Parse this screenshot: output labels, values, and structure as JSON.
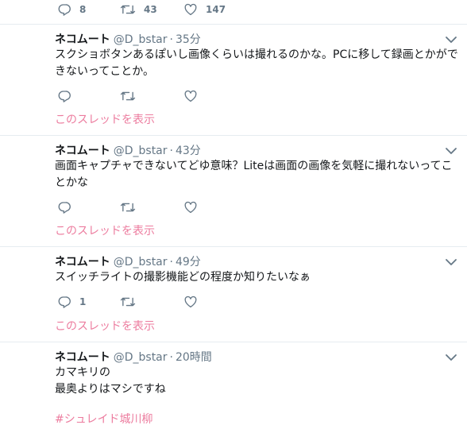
{
  "top_actions": {
    "reply_count": "8",
    "retweet_count": "43",
    "like_count": "147"
  },
  "tweets": [
    {
      "name": "ネコムート",
      "handle": "@D_bstar",
      "separator": "·",
      "time": "35分",
      "text": "スクショボタンあるぽいし画像くらいは撮れるのかな。PCに移して録画とかができないってことか。",
      "reply_count": "",
      "show_thread": "このスレッドを表示"
    },
    {
      "name": "ネコムート",
      "handle": "@D_bstar",
      "separator": "·",
      "time": "43分",
      "text": "画面キャプチャできないてどゆ意味？Liteは画面の画像を気軽に撮れないってことかな",
      "reply_count": "",
      "show_thread": "このスレッドを表示"
    },
    {
      "name": "ネコムート",
      "handle": "@D_bstar",
      "separator": "·",
      "time": "49分",
      "text": "スイッチライトの撮影機能どの程度か知りたいなぁ",
      "reply_count": "1",
      "show_thread": "このスレッドを表示"
    },
    {
      "name": "ネコムート",
      "handle": "@D_bstar",
      "separator": "·",
      "time": "20時間",
      "text": "カマキリの\n最奥よりはマシですね",
      "hashtag": "#シュレイド城川柳"
    }
  ],
  "colors": {
    "link": "#e0245e",
    "secondary": "#657786",
    "border": "#e6ecf0"
  },
  "icons": [
    "reply-icon",
    "retweet-icon",
    "like-icon",
    "chevron-down-icon"
  ]
}
